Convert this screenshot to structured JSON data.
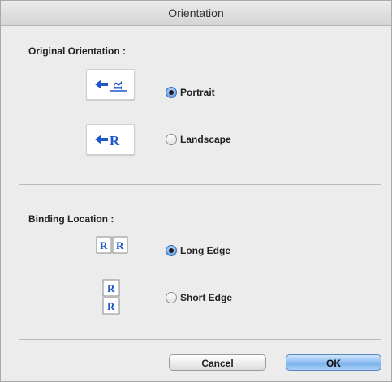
{
  "dialog": {
    "title": "Orientation"
  },
  "original_orientation": {
    "label": "Original Orientation :",
    "options": [
      {
        "label": "Portrait",
        "checked": true,
        "icon": "portrait-orientation-icon"
      },
      {
        "label": "Landscape",
        "checked": false,
        "icon": "landscape-orientation-icon"
      }
    ]
  },
  "binding_location": {
    "label": "Binding Location :",
    "options": [
      {
        "label": "Long Edge",
        "checked": true,
        "icon": "long-edge-binding-icon",
        "glyph": "R"
      },
      {
        "label": "Short Edge",
        "checked": false,
        "icon": "short-edge-binding-icon",
        "glyph": "R"
      }
    ]
  },
  "buttons": {
    "cancel": "Cancel",
    "ok": "OK"
  },
  "colors": {
    "accent_blue": "#1f56c8",
    "default_button": "#7fb4ec"
  }
}
